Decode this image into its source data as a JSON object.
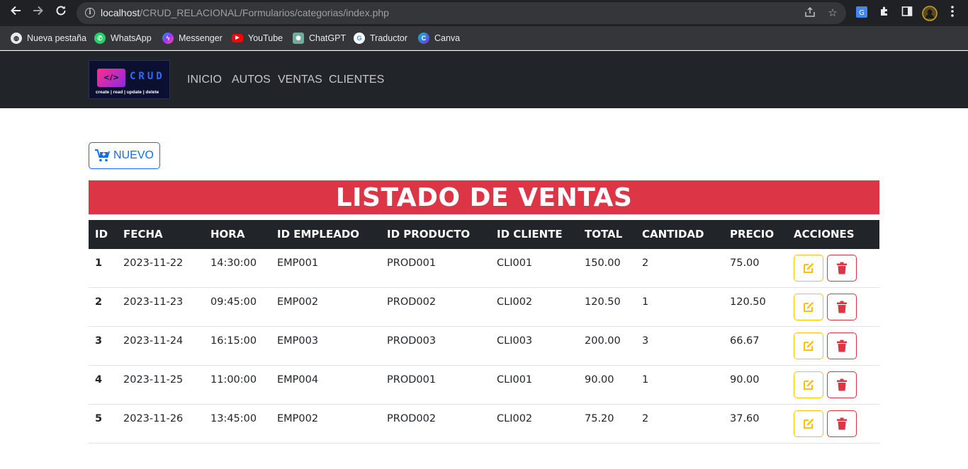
{
  "browser": {
    "url_host": "localhost",
    "url_path": "/CRUD_RELACIONAL/Formularios/categorias/index.php",
    "bookmarks": [
      {
        "label": "Nueva pestaña",
        "icon": "globe-icon"
      },
      {
        "label": "WhatsApp",
        "icon": "whatsapp-icon"
      },
      {
        "label": "Messenger",
        "icon": "messenger-icon"
      },
      {
        "label": "YouTube",
        "icon": "youtube-icon"
      },
      {
        "label": "ChatGPT",
        "icon": "chatgpt-icon"
      },
      {
        "label": "Traductor",
        "icon": "google-icon"
      },
      {
        "label": "Canva",
        "icon": "canva-icon"
      }
    ]
  },
  "navbar": {
    "logo": {
      "word": "CRUD",
      "tagline": "create | read | update | delete",
      "code_glyph": "</>"
    },
    "menu": [
      "INICIO",
      "AUTOS",
      "VENTAS",
      "CLIENTES"
    ]
  },
  "new_button": {
    "label": "NUEVO",
    "icon": "cart-plus-icon"
  },
  "title": "LISTADO DE VENTAS",
  "table": {
    "headers": [
      "ID",
      "FECHA",
      "HORA",
      "ID EMPLEADO",
      "ID PRODUCTO",
      "ID CLIENTE",
      "TOTAL",
      "CANTIDAD",
      "PRECIO",
      "ACCIONES"
    ],
    "rows": [
      [
        "1",
        "2023-11-22",
        "14:30:00",
        "EMP001",
        "PROD001",
        "CLI001",
        "150.00",
        "2",
        "75.00"
      ],
      [
        "2",
        "2023-11-23",
        "09:45:00",
        "EMP002",
        "PROD002",
        "CLI002",
        "120.50",
        "1",
        "120.50"
      ],
      [
        "3",
        "2023-11-24",
        "16:15:00",
        "EMP003",
        "PROD003",
        "CLI003",
        "200.00",
        "3",
        "66.67"
      ],
      [
        "4",
        "2023-11-25",
        "11:00:00",
        "EMP004",
        "PROD001",
        "CLI001",
        "90.00",
        "1",
        "90.00"
      ],
      [
        "5",
        "2023-11-26",
        "13:45:00",
        "EMP002",
        "PROD002",
        "CLI002",
        "75.20",
        "2",
        "37.60"
      ]
    ]
  },
  "colors": {
    "primary": "#0d6efd",
    "danger": "#dc3545",
    "warning": "#ffc107",
    "dark": "#212529"
  }
}
